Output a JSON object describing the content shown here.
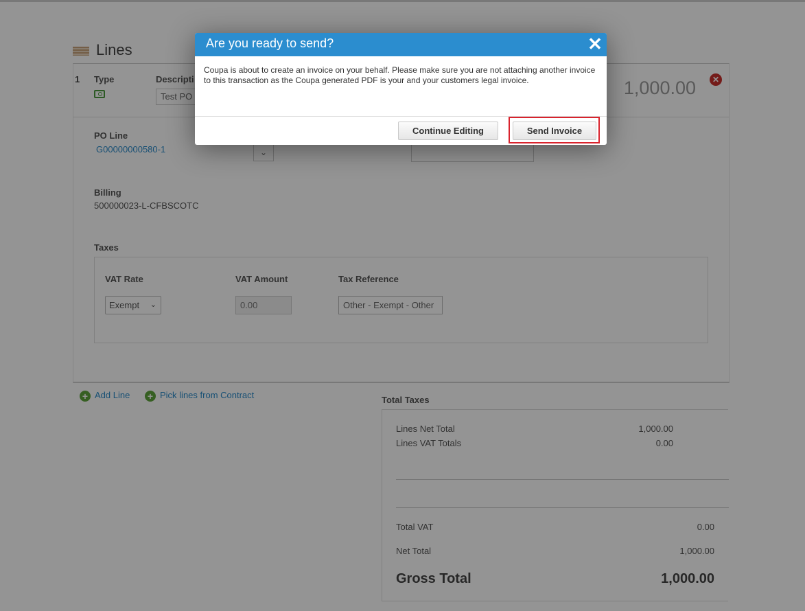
{
  "lines": {
    "title": "Lines",
    "line_number": "1",
    "type_label": "Type",
    "description_label": "Descripti",
    "description_value": "Test PO",
    "line_total": "1,000.00",
    "po_line_label": "PO Line",
    "po_line_value": "G00000000580-1",
    "billing_label": "Billing",
    "billing_value": "500000023-L-CFBSCOTC",
    "taxes_label": "Taxes",
    "vat_rate_label": "VAT Rate",
    "vat_amount_label": "VAT Amount",
    "tax_reference_label": "Tax Reference",
    "vat_rate_value": "Exempt",
    "vat_amount_value": "0.00",
    "tax_reference_value": "Other - Exempt - Other"
  },
  "actions": {
    "add_line": "Add Line",
    "pick_lines": "Pick lines from Contract"
  },
  "totals": {
    "title": "Total Taxes",
    "lines_net_total_label": "Lines Net Total",
    "lines_net_total_value": "1,000.00",
    "lines_vat_totals_label": "Lines VAT Totals",
    "lines_vat_totals_value": "0.00",
    "total_vat_label": "Total VAT",
    "total_vat_value": "0.00",
    "net_total_label": "Net Total",
    "net_total_value": "1,000.00",
    "gross_total_label": "Gross Total",
    "gross_total_value": "1,000.00"
  },
  "modal": {
    "title": "Are you ready to send?",
    "body": "Coupa is about to create an invoice on your behalf. Please make sure you are not attaching another invoice to this transaction as the Coupa generated PDF is your and your customers legal invoice.",
    "continue_label": "Continue Editing",
    "send_label": "Send Invoice"
  },
  "colors": {
    "modal_header": "#2b8dcf",
    "link": "#2a8ac9",
    "highlight": "#d9232d",
    "add_icon": "#5da43c"
  },
  "icons": {
    "close": "close-icon",
    "delete": "delete-icon",
    "add": "plus-circle-icon",
    "type": "money-icon"
  }
}
